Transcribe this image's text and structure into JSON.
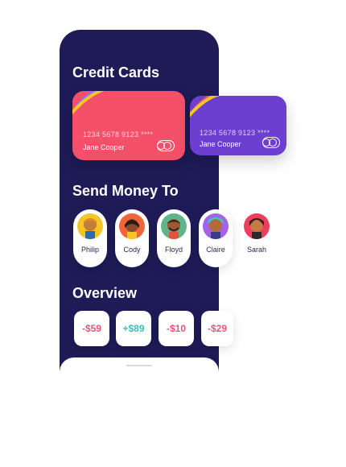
{
  "sections": {
    "credit_cards": "Credit Cards",
    "send_money": "Send Money To",
    "overview": "Overview"
  },
  "cards": [
    {
      "number": "1234 5678 9123 ****",
      "holder": "Jane Cooper",
      "color": "#f4506a"
    },
    {
      "number": "1234 5678 9123 ****",
      "holder": "Jane Cooper",
      "color": "#6d3fd0"
    }
  ],
  "contacts": [
    {
      "name": "Philip",
      "avatar_bg": "#f5c623",
      "icon": "avatar-philip-icon"
    },
    {
      "name": "Cody",
      "avatar_bg": "#f0653a",
      "icon": "avatar-cody-icon"
    },
    {
      "name": "Floyd",
      "avatar_bg": "#5fb58a",
      "icon": "avatar-floyd-icon"
    },
    {
      "name": "Claire",
      "avatar_bg": "#a661e8",
      "icon": "avatar-claire-icon"
    },
    {
      "name": "Sarah",
      "avatar_bg": "#ef3e5d",
      "icon": "avatar-sarah-icon"
    }
  ],
  "overview": [
    {
      "amount": "-$59",
      "color": "#e95679"
    },
    {
      "amount": "+$89",
      "color": "#36c3c0"
    },
    {
      "amount": "-$10",
      "color": "#e95679"
    },
    {
      "amount": "-$29",
      "color": "#e95679"
    }
  ],
  "colors": {
    "background": "#1e1b57",
    "accent_red": "#f4506a",
    "accent_purple": "#6d3fd0"
  }
}
